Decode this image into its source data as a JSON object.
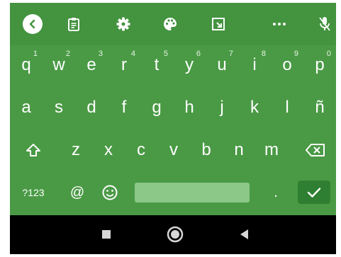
{
  "keyboard": {
    "toolbar": {
      "icons": [
        "back-icon",
        "clipboard-icon",
        "gear-icon",
        "palette-icon",
        "resize-icon",
        "more-icon",
        "mic-off-icon"
      ]
    },
    "row1": [
      {
        "char": "q",
        "hint": "1"
      },
      {
        "char": "w",
        "hint": "2"
      },
      {
        "char": "e",
        "hint": "3"
      },
      {
        "char": "r",
        "hint": "4"
      },
      {
        "char": "t",
        "hint": "5"
      },
      {
        "char": "y",
        "hint": "6"
      },
      {
        "char": "u",
        "hint": "7"
      },
      {
        "char": "i",
        "hint": "8"
      },
      {
        "char": "o",
        "hint": "9"
      },
      {
        "char": "p",
        "hint": "0"
      }
    ],
    "row2": [
      "a",
      "s",
      "d",
      "f",
      "g",
      "h",
      "j",
      "k",
      "l",
      "ñ"
    ],
    "row3": [
      "z",
      "x",
      "c",
      "v",
      "b",
      "n",
      "m"
    ],
    "row4": {
      "symbols": "?123",
      "at": "@",
      "period": "."
    },
    "colors": {
      "background": "#4a9a45",
      "toolbar": "#43933f",
      "space_bar": "#8cc888",
      "enter": "#2f7f32"
    }
  },
  "navbar": {
    "icons": [
      "recents-square-icon",
      "home-circle-icon",
      "back-triangle-icon"
    ]
  }
}
